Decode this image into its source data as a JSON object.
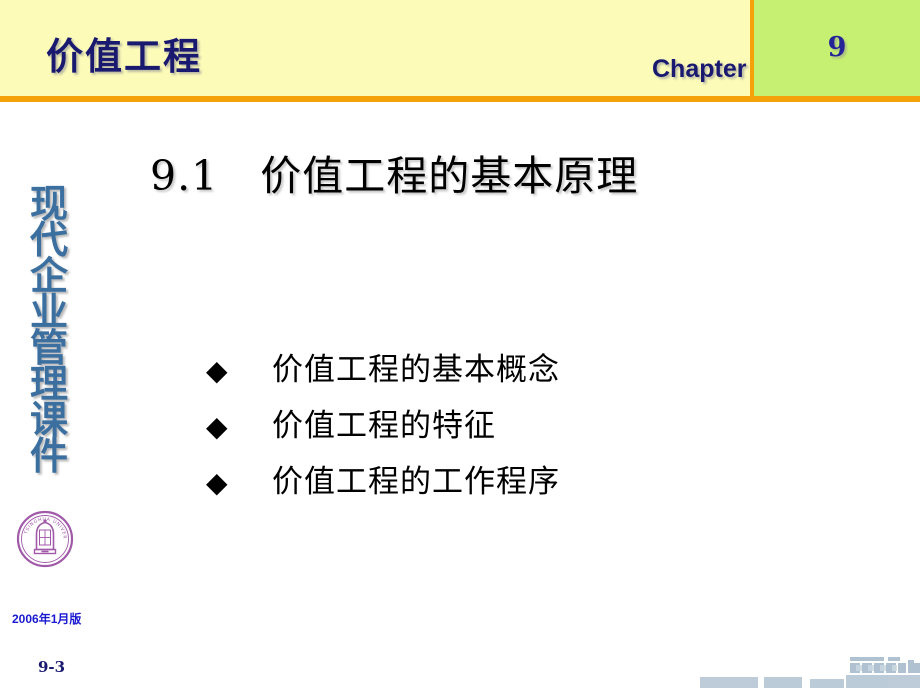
{
  "header": {
    "title": "价值工程",
    "chapter_label": "Chapter",
    "chapter_number": "9",
    "background_color": "#fcfbb8",
    "accent_color": "#f5a20a",
    "chapter_panel_color": "#c6f071",
    "title_color": "#191970"
  },
  "sidebar": {
    "vertical_text": "现代企业管理课件",
    "vertical_chars": [
      "现",
      "代",
      "企",
      "业",
      "管",
      "理",
      "课",
      "件"
    ],
    "text_color": "#3b6fa0",
    "logo": "tsinghua-university-seal",
    "logo_color": "#a05aa8",
    "version_label": "2006年1月版",
    "version_color": "#1a1ad0",
    "page_number": "9-3",
    "page_number_color": "#191970"
  },
  "main": {
    "section_heading": "9.1　价值工程的基本原理",
    "bullet_marker": "◆",
    "bullets": [
      {
        "text": "价值工程的基本概念"
      },
      {
        "text": "价值工程的特征"
      },
      {
        "text": "价值工程的工作程序"
      }
    ]
  },
  "decoration": {
    "name": "bottom-right-blocks",
    "color": "#b6c6d4"
  }
}
